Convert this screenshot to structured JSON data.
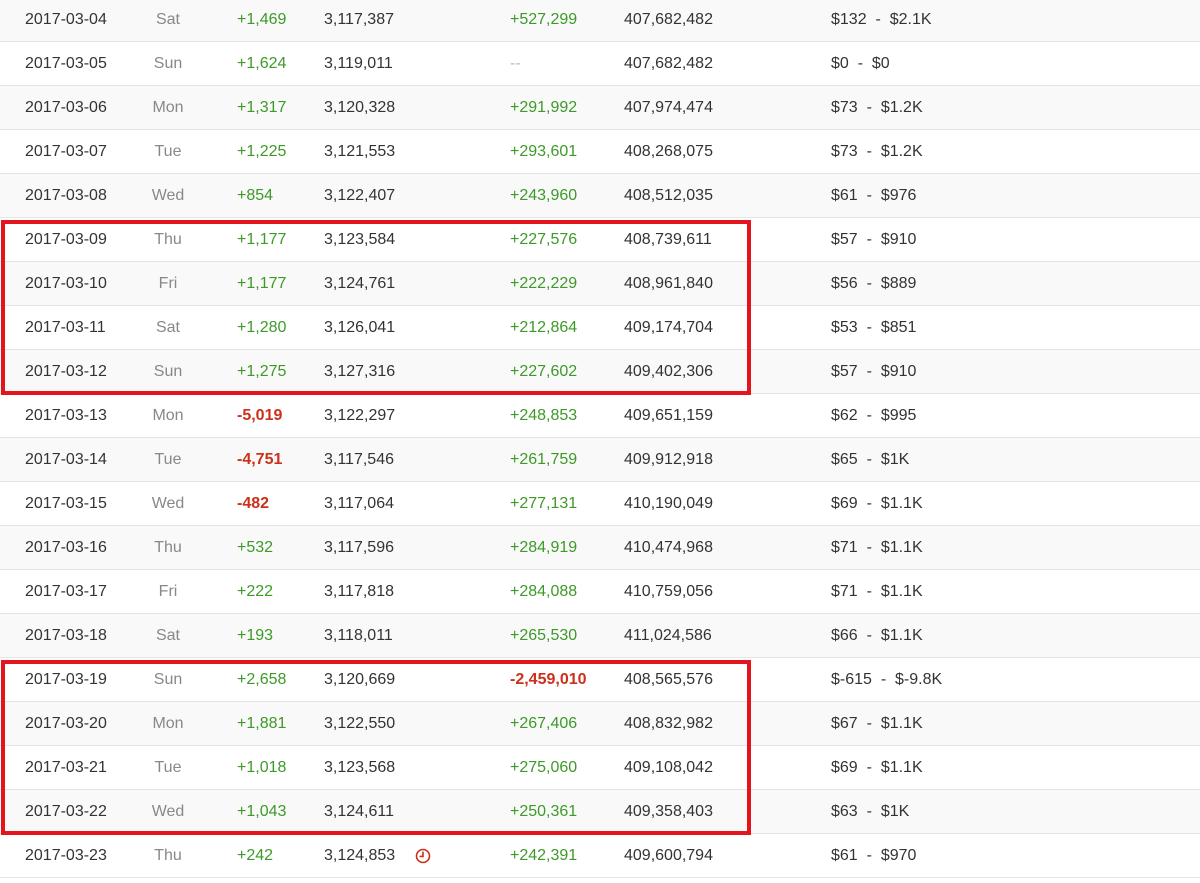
{
  "rows": [
    {
      "date": "2017-03-04",
      "day": "Sat",
      "delta": "+1,469",
      "delta_type": "pos",
      "total": "3,117,387",
      "views_delta": "+527,299",
      "views_delta_type": "pos",
      "views_total": "407,682,482",
      "earn_low": "$132",
      "earn_high": "$2.1K",
      "icon": false
    },
    {
      "date": "2017-03-05",
      "day": "Sun",
      "delta": "+1,624",
      "delta_type": "pos",
      "total": "3,119,011",
      "views_delta": "--",
      "views_delta_type": "na",
      "views_total": "407,682,482",
      "earn_low": "$0",
      "earn_high": "$0",
      "icon": false
    },
    {
      "date": "2017-03-06",
      "day": "Mon",
      "delta": "+1,317",
      "delta_type": "pos",
      "total": "3,120,328",
      "views_delta": "+291,992",
      "views_delta_type": "pos",
      "views_total": "407,974,474",
      "earn_low": "$73",
      "earn_high": "$1.2K",
      "icon": false
    },
    {
      "date": "2017-03-07",
      "day": "Tue",
      "delta": "+1,225",
      "delta_type": "pos",
      "total": "3,121,553",
      "views_delta": "+293,601",
      "views_delta_type": "pos",
      "views_total": "408,268,075",
      "earn_low": "$73",
      "earn_high": "$1.2K",
      "icon": false
    },
    {
      "date": "2017-03-08",
      "day": "Wed",
      "delta": "+854",
      "delta_type": "pos",
      "total": "3,122,407",
      "views_delta": "+243,960",
      "views_delta_type": "pos",
      "views_total": "408,512,035",
      "earn_low": "$61",
      "earn_high": "$976",
      "icon": false
    },
    {
      "date": "2017-03-09",
      "day": "Thu",
      "delta": "+1,177",
      "delta_type": "pos",
      "total": "3,123,584",
      "views_delta": "+227,576",
      "views_delta_type": "pos",
      "views_total": "408,739,611",
      "earn_low": "$57",
      "earn_high": "$910",
      "icon": false
    },
    {
      "date": "2017-03-10",
      "day": "Fri",
      "delta": "+1,177",
      "delta_type": "pos",
      "total": "3,124,761",
      "views_delta": "+222,229",
      "views_delta_type": "pos",
      "views_total": "408,961,840",
      "earn_low": "$56",
      "earn_high": "$889",
      "icon": false
    },
    {
      "date": "2017-03-11",
      "day": "Sat",
      "delta": "+1,280",
      "delta_type": "pos",
      "total": "3,126,041",
      "views_delta": "+212,864",
      "views_delta_type": "pos",
      "views_total": "409,174,704",
      "earn_low": "$53",
      "earn_high": "$851",
      "icon": false
    },
    {
      "date": "2017-03-12",
      "day": "Sun",
      "delta": "+1,275",
      "delta_type": "pos",
      "total": "3,127,316",
      "views_delta": "+227,602",
      "views_delta_type": "pos",
      "views_total": "409,402,306",
      "earn_low": "$57",
      "earn_high": "$910",
      "icon": false
    },
    {
      "date": "2017-03-13",
      "day": "Mon",
      "delta": "-5,019",
      "delta_type": "neg",
      "total": "3,122,297",
      "views_delta": "+248,853",
      "views_delta_type": "pos",
      "views_total": "409,651,159",
      "earn_low": "$62",
      "earn_high": "$995",
      "icon": false
    },
    {
      "date": "2017-03-14",
      "day": "Tue",
      "delta": "-4,751",
      "delta_type": "neg",
      "total": "3,117,546",
      "views_delta": "+261,759",
      "views_delta_type": "pos",
      "views_total": "409,912,918",
      "earn_low": "$65",
      "earn_high": "$1K",
      "icon": false
    },
    {
      "date": "2017-03-15",
      "day": "Wed",
      "delta": "-482",
      "delta_type": "neg",
      "total": "3,117,064",
      "views_delta": "+277,131",
      "views_delta_type": "pos",
      "views_total": "410,190,049",
      "earn_low": "$69",
      "earn_high": "$1.1K",
      "icon": false
    },
    {
      "date": "2017-03-16",
      "day": "Thu",
      "delta": "+532",
      "delta_type": "pos",
      "total": "3,117,596",
      "views_delta": "+284,919",
      "views_delta_type": "pos",
      "views_total": "410,474,968",
      "earn_low": "$71",
      "earn_high": "$1.1K",
      "icon": false
    },
    {
      "date": "2017-03-17",
      "day": "Fri",
      "delta": "+222",
      "delta_type": "pos",
      "total": "3,117,818",
      "views_delta": "+284,088",
      "views_delta_type": "pos",
      "views_total": "410,759,056",
      "earn_low": "$71",
      "earn_high": "$1.1K",
      "icon": false
    },
    {
      "date": "2017-03-18",
      "day": "Sat",
      "delta": "+193",
      "delta_type": "pos",
      "total": "3,118,011",
      "views_delta": "+265,530",
      "views_delta_type": "pos",
      "views_total": "411,024,586",
      "earn_low": "$66",
      "earn_high": "$1.1K",
      "icon": false
    },
    {
      "date": "2017-03-19",
      "day": "Sun",
      "delta": "+2,658",
      "delta_type": "pos",
      "total": "3,120,669",
      "views_delta": "-2,459,010",
      "views_delta_type": "neg",
      "views_total": "408,565,576",
      "earn_low": "$-615",
      "earn_high": "$-9.8K",
      "icon": false
    },
    {
      "date": "2017-03-20",
      "day": "Mon",
      "delta": "+1,881",
      "delta_type": "pos",
      "total": "3,122,550",
      "views_delta": "+267,406",
      "views_delta_type": "pos",
      "views_total": "408,832,982",
      "earn_low": "$67",
      "earn_high": "$1.1K",
      "icon": false
    },
    {
      "date": "2017-03-21",
      "day": "Tue",
      "delta": "+1,018",
      "delta_type": "pos",
      "total": "3,123,568",
      "views_delta": "+275,060",
      "views_delta_type": "pos",
      "views_total": "409,108,042",
      "earn_low": "$69",
      "earn_high": "$1.1K",
      "icon": false
    },
    {
      "date": "2017-03-22",
      "day": "Wed",
      "delta": "+1,043",
      "delta_type": "pos",
      "total": "3,124,611",
      "views_delta": "+250,361",
      "views_delta_type": "pos",
      "views_total": "409,358,403",
      "earn_low": "$63",
      "earn_high": "$1K",
      "icon": false
    },
    {
      "date": "2017-03-23",
      "day": "Thu",
      "delta": "+242",
      "delta_type": "pos",
      "total": "3,124,853",
      "views_delta": "+242,391",
      "views_delta_type": "pos",
      "views_total": "409,600,794",
      "earn_low": "$61",
      "earn_high": "$970",
      "icon": true
    }
  ],
  "earn_separator": "  -  ",
  "colors": {
    "positive": "#3c9a27",
    "negative": "#cc2f1a",
    "highlight": "#e3141b",
    "row_alt": "#f9f9f9",
    "border": "#e4e4e4"
  },
  "icons": {
    "pending": "clock-icon"
  }
}
